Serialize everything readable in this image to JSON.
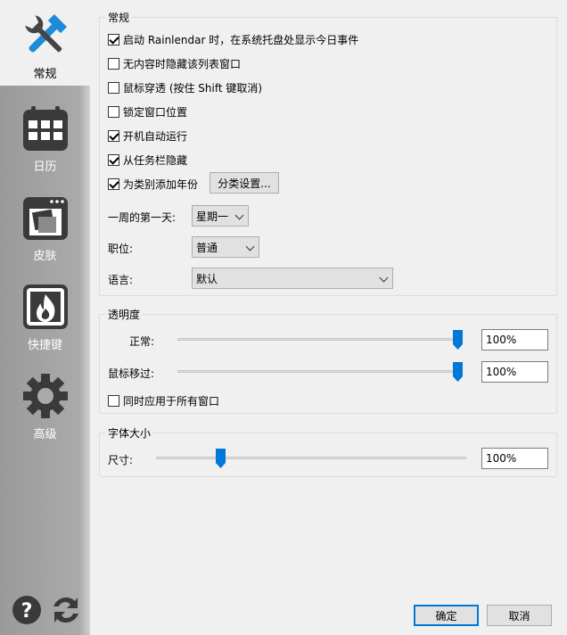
{
  "sidebar": {
    "items": [
      {
        "label": "常规",
        "icon": "tools-icon",
        "active": true
      },
      {
        "label": "日历",
        "icon": "calendar-icon"
      },
      {
        "label": "皮肤",
        "icon": "skin-icon"
      },
      {
        "label": "快捷键",
        "icon": "hotkey-flame-icon"
      },
      {
        "label": "高级",
        "icon": "gear-icon"
      }
    ],
    "footer": {
      "help_icon": "help-icon",
      "refresh_icon": "refresh-icon"
    }
  },
  "general": {
    "title": "常规",
    "checkboxes": [
      {
        "label": "启动 Rainlendar 时，在系统托盘处显示今日事件",
        "checked": true
      },
      {
        "label": "无内容时隐藏该列表窗口",
        "checked": false
      },
      {
        "label": "鼠标穿透 (按住 Shift 键取消)",
        "checked": false
      },
      {
        "label": "锁定窗口位置",
        "checked": false
      },
      {
        "label": "开机自动运行",
        "checked": true
      },
      {
        "label": "从任务栏隐藏",
        "checked": true
      },
      {
        "label": "为类别添加年份",
        "checked": true
      }
    ],
    "category_button": "分类设置...",
    "first_day_label": "一周的第一天:",
    "first_day_value": "星期一",
    "position_label": "职位:",
    "position_value": "普通",
    "language_label": "语言:",
    "language_value": "默认"
  },
  "opacity": {
    "title": "透明度",
    "normal_label": "正常:",
    "normal_value": "100%",
    "normal_level": 1.0,
    "hover_label": "鼠标移过:",
    "hover_value": "100%",
    "hover_level": 1.0,
    "apply_all_label": "同时应用于所有窗口",
    "apply_all_checked": false
  },
  "font": {
    "title": "字体大小",
    "size_label": "尺寸:",
    "size_value": "100%",
    "size_level": 0.2
  },
  "footer": {
    "ok": "确定",
    "cancel": "取消"
  },
  "colors": {
    "accent": "#0078d7",
    "sidebar_bg": "#aaaaaa",
    "panel_bg": "#f0f0f0"
  }
}
